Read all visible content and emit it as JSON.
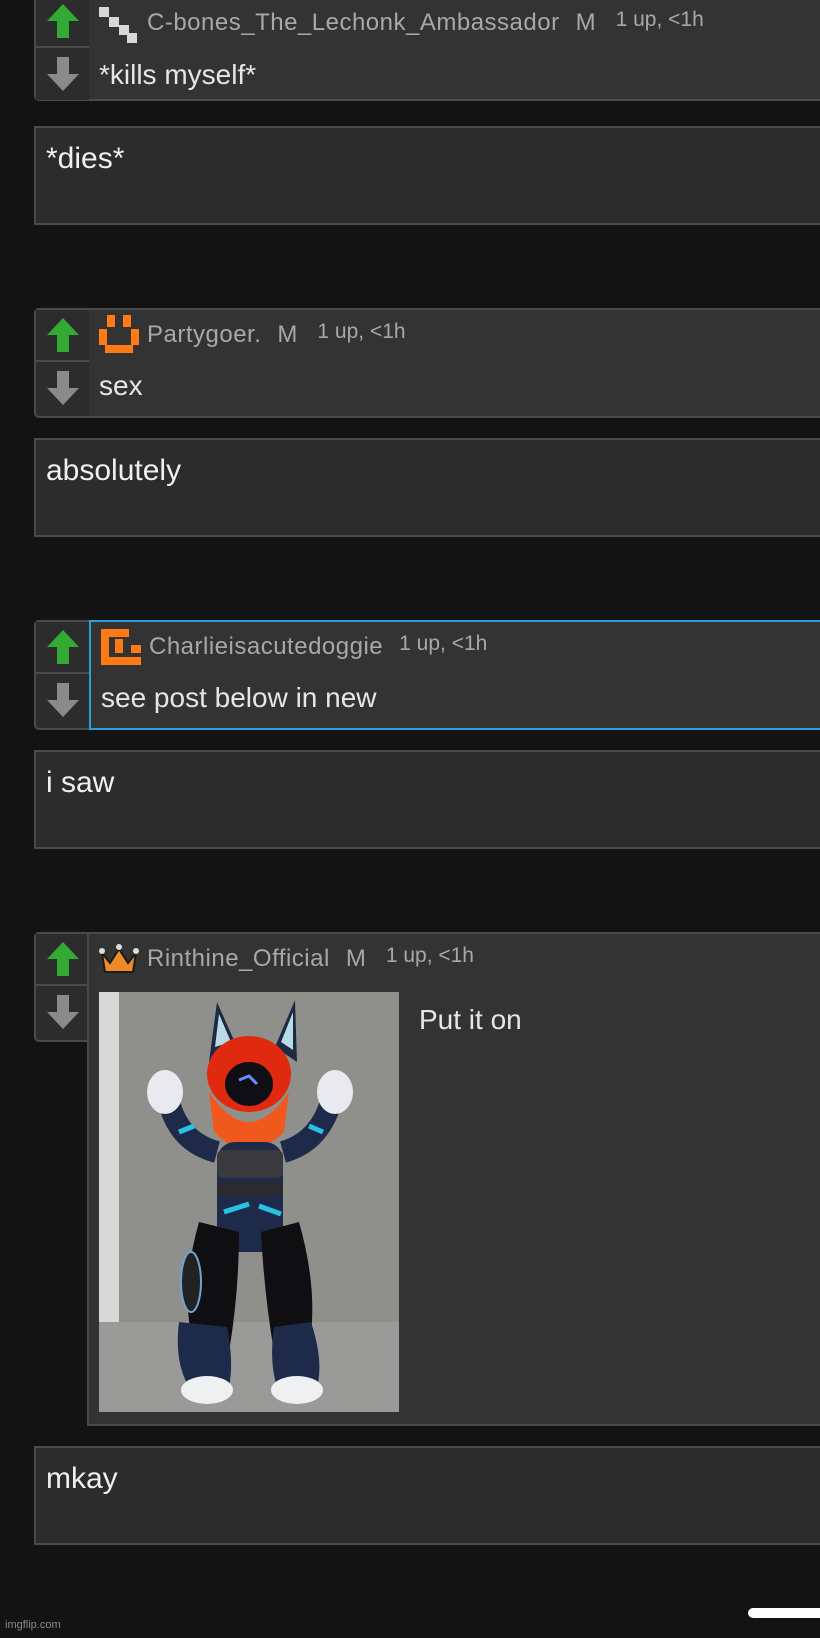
{
  "colors": {
    "background": "#131313",
    "panel": "#333333",
    "upvote": "#33aa33",
    "downvote": "#8a8a8a",
    "highlight_border": "#2a9fd6",
    "avatar_orange": "#ff7a14"
  },
  "comments": [
    {
      "username": "C-bones_The_Lechonk_Ambassador",
      "mod_badge": "M",
      "stats": "1 up, <1h",
      "text": "*kills myself*",
      "avatar_icon": "pixel-avatar-icon"
    },
    {
      "username": "Partygoer.",
      "mod_badge": "M",
      "stats": "1 up, <1h",
      "text": "sex",
      "avatar_icon": "pixel-avatar-icon"
    },
    {
      "username": "Charlieisacutedoggie",
      "stats": "1 up, <1h",
      "text": "see post below in new",
      "avatar_icon": "pixel-avatar-icon"
    },
    {
      "username": "Rinthine_Official",
      "mod_badge": "M",
      "stats": "1 up, <1h",
      "text": "Put it on",
      "avatar_icon": "crown-icon",
      "image_icon": "fursuit-photo"
    }
  ],
  "replies": [
    {
      "text": "*dies*"
    },
    {
      "text": "absolutely"
    },
    {
      "text": "i saw"
    },
    {
      "text": "mkay"
    }
  ],
  "watermark": "imgflip.com"
}
